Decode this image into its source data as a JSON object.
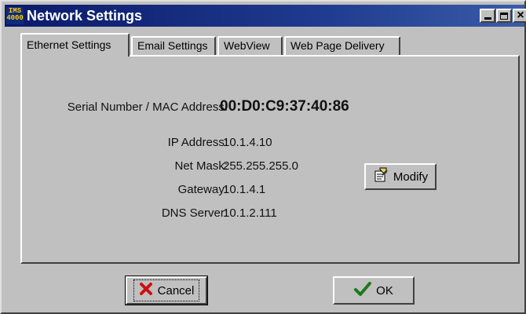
{
  "window": {
    "app_icon_text": "IMS 4000",
    "title": "Network Settings",
    "buttons": {
      "minimize": "minimize",
      "maximize": "maximize",
      "close": "close"
    }
  },
  "tabs": [
    {
      "label": "Ethernet Settings",
      "active": true
    },
    {
      "label": "Email Settings",
      "active": false
    },
    {
      "label": "WebView",
      "active": false
    },
    {
      "label": "Web Page Delivery",
      "active": false
    }
  ],
  "ethernet": {
    "serial_label": "Serial Number / MAC Address:",
    "serial_value": "00:D0:C9:37:40:86",
    "fields": [
      {
        "label": "IP Address:",
        "value": "10.1.4.10"
      },
      {
        "label": "Net Mask:",
        "value": "255.255.255.0"
      },
      {
        "label": "Gateway:",
        "value": "10.1.4.1"
      },
      {
        "label": "DNS Server:",
        "value": "10.1.2.111"
      }
    ],
    "modify_label": "Modify"
  },
  "footer": {
    "cancel_label": "Cancel",
    "ok_label": "OK"
  },
  "colors": {
    "titlebar": "#0a1a6a",
    "face": "#c0c0c0",
    "cancel_x": "#cc1010",
    "ok_check": "#1a7a1a"
  }
}
